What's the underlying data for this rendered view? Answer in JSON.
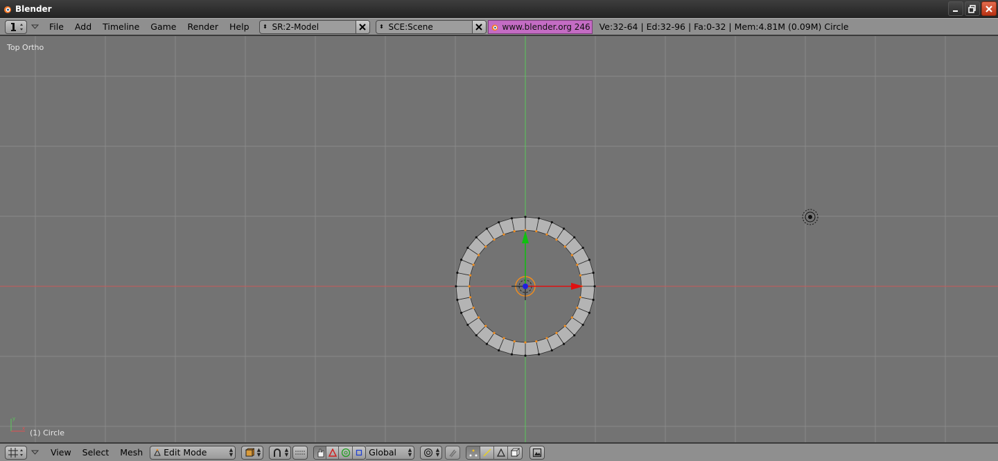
{
  "window": {
    "title": "Blender"
  },
  "info_header": {
    "menus": [
      "File",
      "Add",
      "Timeline",
      "Game",
      "Render",
      "Help"
    ],
    "screen_field": "SR:2-Model",
    "scene_field": "SCE:Scene",
    "site_label": "www.blender.org 246",
    "stats": "Ve:32-64 | Ed:32-96 | Fa:0-32 | Mem:4.81M (0.09M) Circle"
  },
  "viewport": {
    "view_label": "Top Ortho",
    "object_label": "(1) Circle",
    "mesh_vertex_count": 32,
    "colors": {
      "background": "#737373",
      "grid": "#8a8a8a",
      "x_axis": "#c85a5a",
      "y_axis": "#5ac85a",
      "mesh_face": "#b4b4b4",
      "selected_vertex": "#f08c1e",
      "manipulator_x": "#e01010",
      "manipulator_y": "#10c010",
      "manipulator_center": "#2020e0"
    }
  },
  "view3d_header": {
    "menus": [
      "View",
      "Select",
      "Mesh"
    ],
    "mode": "Edit Mode",
    "orientation": "Global"
  },
  "icons": {
    "blender_logo": "blender-logo-icon",
    "info": "info-icon",
    "view3d": "view3d-icon"
  }
}
